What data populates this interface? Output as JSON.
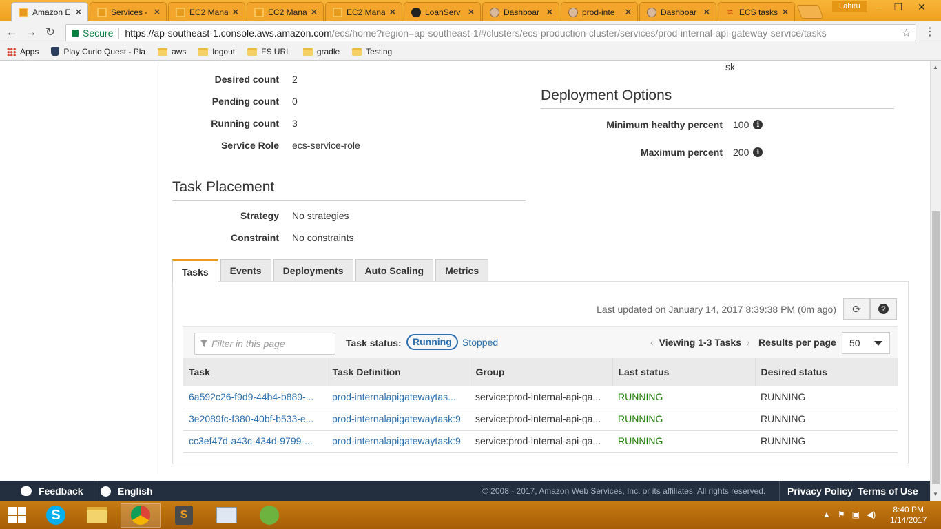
{
  "browser": {
    "tabs": [
      {
        "label": "Amazon E",
        "icon": "aws-icon",
        "active": true
      },
      {
        "label": "Services -",
        "icon": "aws-icon"
      },
      {
        "label": "EC2 Mana",
        "icon": "aws-icon"
      },
      {
        "label": "EC2 Mana",
        "icon": "aws-icon"
      },
      {
        "label": "EC2 Mana",
        "icon": "aws-icon"
      },
      {
        "label": "LoanServ",
        "icon": "github-icon"
      },
      {
        "label": "Dashboar",
        "icon": "jenkins-icon"
      },
      {
        "label": "prod-inte",
        "icon": "jenkins-icon"
      },
      {
        "label": "Dashboar",
        "icon": "jenkins-icon"
      },
      {
        "label": "ECS tasks",
        "icon": "stackoverflow-icon"
      }
    ],
    "user": "Lahiru",
    "address": {
      "secure_label": "Secure",
      "host": "https://ap-southeast-1.console.aws.amazon.com",
      "path": "/ecs/home?region=ap-southeast-1#/clusters/ecs-production-cluster/services/prod-internal-api-gateway-service/tasks"
    },
    "bookmarks": [
      "Apps",
      "Play Curio Quest - Pla",
      "aws",
      "logout",
      "FS URL",
      "gradle",
      "Testing"
    ]
  },
  "service": {
    "fragment_top_right": "sk",
    "details": [
      {
        "label": "Desired count",
        "value": "2"
      },
      {
        "label": "Pending count",
        "value": "0"
      },
      {
        "label": "Running count",
        "value": "3"
      },
      {
        "label": "Service Role",
        "value": "ecs-service-role"
      }
    ],
    "deployment_options": {
      "title": "Deployment Options",
      "items": [
        {
          "label": "Minimum healthy percent",
          "value": "100"
        },
        {
          "label": "Maximum percent",
          "value": "200"
        }
      ]
    },
    "task_placement": {
      "title": "Task Placement",
      "items": [
        {
          "label": "Strategy",
          "value": "No strategies"
        },
        {
          "label": "Constraint",
          "value": "No constraints"
        }
      ]
    }
  },
  "tabs": [
    "Tasks",
    "Events",
    "Deployments",
    "Auto Scaling",
    "Metrics"
  ],
  "tasks_panel": {
    "last_updated": "Last updated on January 14, 2017 8:39:38 PM (0m ago)",
    "filter_placeholder": "Filter in this page",
    "task_status_label": "Task status:",
    "status_running": "Running",
    "status_stopped": "Stopped",
    "viewing": "Viewing 1-3 Tasks",
    "results_per_page_label": "Results per page",
    "results_per_page": "50",
    "columns": [
      "Task",
      "Task Definition",
      "Group",
      "Last status",
      "Desired status"
    ],
    "rows": [
      [
        "6a592c26-f9d9-44b4-b889-...",
        "prod-internalapigatewaytas...",
        "service:prod-internal-api-ga...",
        "RUNNING",
        "RUNNING"
      ],
      [
        "3e2089fc-f380-40bf-b533-e...",
        "prod-internalapigatewaytask:9",
        "service:prod-internal-api-ga...",
        "RUNNING",
        "RUNNING"
      ],
      [
        "cc3ef47d-a43c-434d-9799-...",
        "prod-internalapigatewaytask:9",
        "service:prod-internal-api-ga...",
        "RUNNING",
        "RUNNING"
      ]
    ]
  },
  "footer": {
    "feedback": "Feedback",
    "language": "English",
    "copyright": "© 2008 - 2017, Amazon Web Services, Inc. or its affiliates. All rights reserved.",
    "privacy": "Privacy Policy",
    "terms": "Terms of Use"
  },
  "taskbar": {
    "time": "8:40 PM",
    "date": "1/14/2017"
  },
  "colors": {
    "aws_orange": "#e89a1b",
    "link_blue": "#2a6fb0",
    "running_green": "#1d8102",
    "footer_bg": "#232f3e"
  }
}
